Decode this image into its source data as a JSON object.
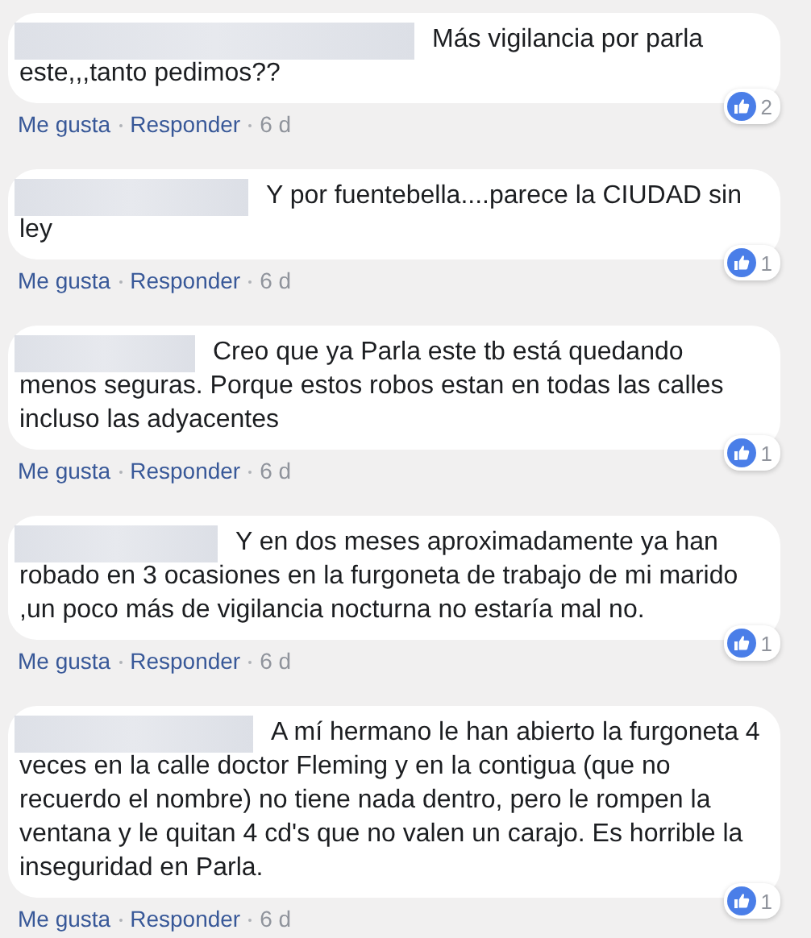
{
  "comments": [
    {
      "text": "Más vigilancia por parla este,,,tanto pedimos??",
      "actions": [
        "Me gusta",
        "Responder"
      ],
      "time": "6 d",
      "reactions": "2"
    },
    {
      "text": "Y por fuentebella....parece la CIUDAD sin ley",
      "actions": [
        "Me gusta",
        "Responder"
      ],
      "time": "6 d",
      "reactions": "1"
    },
    {
      "text": "Creo que ya Parla este tb está quedando menos seguras. Porque estos robos estan en todas las calles incluso las adyacentes",
      "actions": [
        "Me gusta",
        "Responder"
      ],
      "time": "6 d",
      "reactions": "1"
    },
    {
      "text": "Y en dos meses aproximadamente ya han robado en 3 ocasiones en la furgoneta de trabajo de mi marido ,un poco más de vigilancia nocturna no estaría mal no.",
      "actions": [
        "Me gusta",
        "Responder"
      ],
      "time": "6 d",
      "reactions": "1"
    },
    {
      "text": "A mí hermano le han abierto la furgoneta 4 veces en la calle doctor Fleming y en la contigua (que no recuerdo el nombre) no tiene nada dentro, pero le rompen la ventana y le quitan 4 cd's que no valen un carajo. Es horrible la inseguridad en Parla.",
      "actions": [
        "Me gusta",
        "Responder"
      ],
      "time": "6 d",
      "reactions": "1"
    }
  ]
}
